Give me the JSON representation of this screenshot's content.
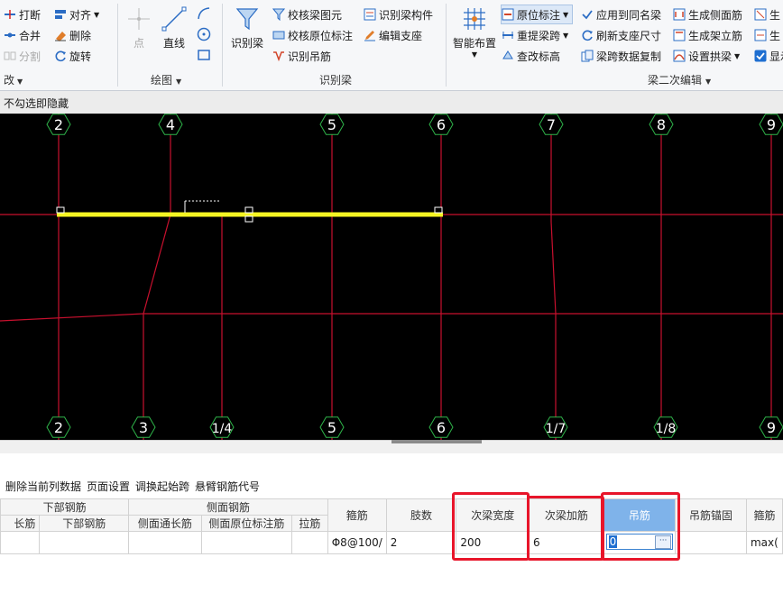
{
  "ribbon": {
    "modify": {
      "break": "打断",
      "align": "对齐",
      "merge": "合并",
      "delete": "删除",
      "split": "分割",
      "rotate": "旋转",
      "group_title_partial": "改"
    },
    "draw": {
      "point": "点",
      "line": "直线",
      "group_title": "绘图"
    },
    "identify": {
      "identify_beam": "识别梁",
      "check_beam_primitive": "校核梁图元",
      "check_in_situ_label": "校核原位标注",
      "identify_hanger_bar": "识别吊筋",
      "identify_beam_component": "识别梁构件",
      "edit_support": "编辑支座",
      "group_title": "识别梁"
    },
    "secondary_edit": {
      "smart_layout": "智能布置",
      "in_situ_label": "原位标注",
      "re_extract_span": "重提梁跨",
      "modify_elevation": "查改标高",
      "apply_same_name": "应用到同名梁",
      "refresh_support_size": "刷新支座尺寸",
      "span_data_copy": "梁跨数据复制",
      "gen_side_bar": "生成侧面筋",
      "gen_erection_bar": "生成架立筋",
      "set_arch_bar": "设置拱梁",
      "partial_gen": "生",
      "partial_show": "显示",
      "group_title": "梁二次编辑"
    }
  },
  "status": {
    "hint": "不勾选即隐藏"
  },
  "canvas": {
    "top_axes": [
      "2",
      "4",
      "5",
      "6",
      "7",
      "8",
      "9"
    ],
    "bottom_axes": [
      "2",
      "3",
      "1/4",
      "5",
      "6",
      "1/7",
      "1/8",
      "9"
    ],
    "colors": {
      "grid": "#c8102e",
      "beam": "#f5f523",
      "axis_text": "#ffffff",
      "axis_circle": "#2fb54a"
    }
  },
  "panel": {
    "toolbar": [
      "删除当前列数据",
      "页面设置",
      "调换起始跨",
      "悬臂钢筋代号"
    ],
    "groups": {
      "lower_bar": "下部钢筋",
      "side_bar": "侧面钢筋"
    },
    "headers": {
      "lower_through_partial": "长筋",
      "lower_bar": "下部钢筋",
      "side_through": "侧面通长筋",
      "side_in_situ": "侧面原位标注筋",
      "tie_bar": "拉筋",
      "stirrup": "箍筋",
      "legs": "肢数",
      "sec_beam_width": "次梁宽度",
      "sec_beam_add_bar": "次梁加筋",
      "hanger_bar": "吊筋",
      "hanger_anchor": "吊筋锚固",
      "stirrup_partial": "箍筋"
    },
    "row": {
      "stirrup": "Φ8@100/",
      "legs": "2",
      "sec_beam_width": "200",
      "sec_beam_add_bar": "6",
      "hanger_bar": "0",
      "hanger_anchor": "",
      "last": "max("
    },
    "ellipsis": "···",
    "highlight_color": "#e8152a"
  }
}
